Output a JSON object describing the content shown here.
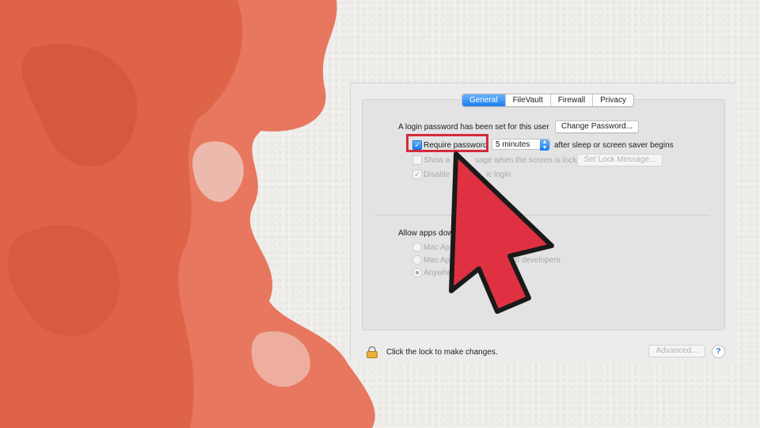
{
  "tabs": [
    "General",
    "FileVault",
    "Firewall",
    "Privacy"
  ],
  "active_tab": "General",
  "login_password_text": "A login password has been set for this user",
  "change_password_label": "Change Password...",
  "require_password_label": "Require password",
  "require_password_checked": true,
  "password_delay": "5 minutes",
  "after_sleep_text": "after sleep or screen saver begins",
  "show_message_label_start": "Show a",
  "show_message_label_end": "sage when the screen is locked",
  "set_lock_message_label": "Set Lock Message...",
  "disable_label_start": "Disable",
  "disable_label_end": "ic login",
  "allow_apps_label": "Allow apps dow",
  "radio_1": "Mac Ap",
  "radio_2_start": "Mac Ap",
  "radio_2_end": "ed developers",
  "radio_3": "Anywhe",
  "lock_text": "Click the lock to make changes.",
  "advanced_label": "Advanced...",
  "help_label": "?",
  "colors": {
    "accent": "#197cf1",
    "highlight_box": "#d42b3b",
    "arrow_fill": "#e03142",
    "watercolor": "#e06a4e"
  }
}
